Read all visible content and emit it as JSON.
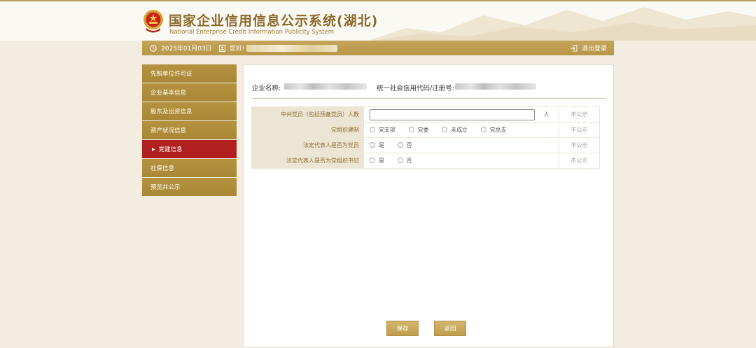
{
  "header": {
    "title_cn": "国家企业信用信息公示系统(湖北)",
    "title_en": "National Enterprise Credit Information Publicity System"
  },
  "topbar": {
    "date": "2025年01月03日",
    "greeting": "您好!",
    "logout": "退出登录"
  },
  "sidebar": {
    "items": [
      {
        "label": "先照单位许可证"
      },
      {
        "label": "企业基本信息"
      },
      {
        "label": "股东及出资信息"
      },
      {
        "label": "资产状况信息"
      },
      {
        "label": "党建信息",
        "active": true
      },
      {
        "label": "社保信息"
      },
      {
        "label": "预览并公示"
      }
    ]
  },
  "main": {
    "company_label": "企业名称:",
    "code_label": "统一社会信用代码/注册号:",
    "rows": [
      {
        "label": "中共党员（包括预备党员）人数",
        "unit": "人",
        "public": "不公示"
      },
      {
        "label": "党组织建制",
        "options": [
          "党支部",
          "党委",
          "未成立",
          "党总支"
        ],
        "public": "不公示"
      },
      {
        "label": "法定代表人是否为党员",
        "options": [
          "是",
          "否"
        ],
        "public": "不公示"
      },
      {
        "label": "法定代表人是否为党组织书记",
        "options": [
          "是",
          "否"
        ],
        "public": "不公示"
      }
    ],
    "save_label": "保存",
    "back_label": "返回"
  },
  "colors": {
    "gold": "#b89648",
    "active_red": "#b21f1f",
    "label_bg": "#ede5d4"
  }
}
